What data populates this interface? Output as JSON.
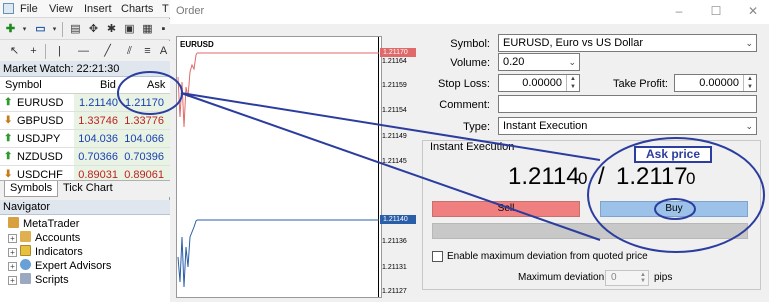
{
  "menu": [
    "File",
    "View",
    "Insert",
    "Charts",
    "T"
  ],
  "market_watch": {
    "title": "Market Watch: 22:21:30",
    "headers": {
      "symbol": "Symbol",
      "bid": "Bid",
      "ask": "Ask"
    },
    "rows": [
      {
        "symbol": "EURUSD",
        "bid": "1.21140",
        "ask": "1.21170",
        "dir": "up"
      },
      {
        "symbol": "GBPUSD",
        "bid": "1.33746",
        "ask": "1.33776",
        "dir": "down"
      },
      {
        "symbol": "USDJPY",
        "bid": "104.036",
        "ask": "104.066",
        "dir": "up"
      },
      {
        "symbol": "NZDUSD",
        "bid": "0.70366",
        "ask": "0.70396",
        "dir": "up"
      },
      {
        "symbol": "USDCHF",
        "bid": "0.89031",
        "ask": "0.89061",
        "dir": "down"
      }
    ],
    "tabs": [
      "Symbols",
      "Tick Chart"
    ]
  },
  "navigator": {
    "title": "Navigator",
    "items": [
      "MetaTrader",
      "Accounts",
      "Indicators",
      "Expert Advisors",
      "Scripts"
    ]
  },
  "order": {
    "title": "Order",
    "chart_symbol": "EURUSD",
    "ticks": [
      "1.21164",
      "1.21159",
      "1.21154",
      "1.21149",
      "1.21145",
      "1.21136",
      "1.21131",
      "1.21127"
    ],
    "ask_tag": "1.21170",
    "bid_tag": "1.21140",
    "symbol_label": "Symbol:",
    "symbol_value": "EURUSD, Euro vs US Dollar",
    "volume_label": "Volume:",
    "volume_value": "0.20",
    "stop_loss_label": "Stop Loss:",
    "stop_loss_value": "0.00000",
    "take_profit_label": "Take Profit:",
    "take_profit_value": "0.00000",
    "comment_label": "Comment:",
    "comment_value": "",
    "type_label": "Type:",
    "type_value": "Instant Execution",
    "section_title": "Instant Execution",
    "bid_main": "1.2114",
    "bid_small": "0",
    "separator": "/",
    "ask_main": "1.2117",
    "ask_small": "0",
    "sell_label": "Sell",
    "buy_label": "Buy",
    "deviation_check_label": "Enable maximum deviation from quoted price",
    "deviation_label": "Maximum deviation:",
    "deviation_value": "0",
    "pips_label": "pips"
  },
  "annotation": {
    "callout": "Ask price",
    "color": "#2b3d9e"
  }
}
